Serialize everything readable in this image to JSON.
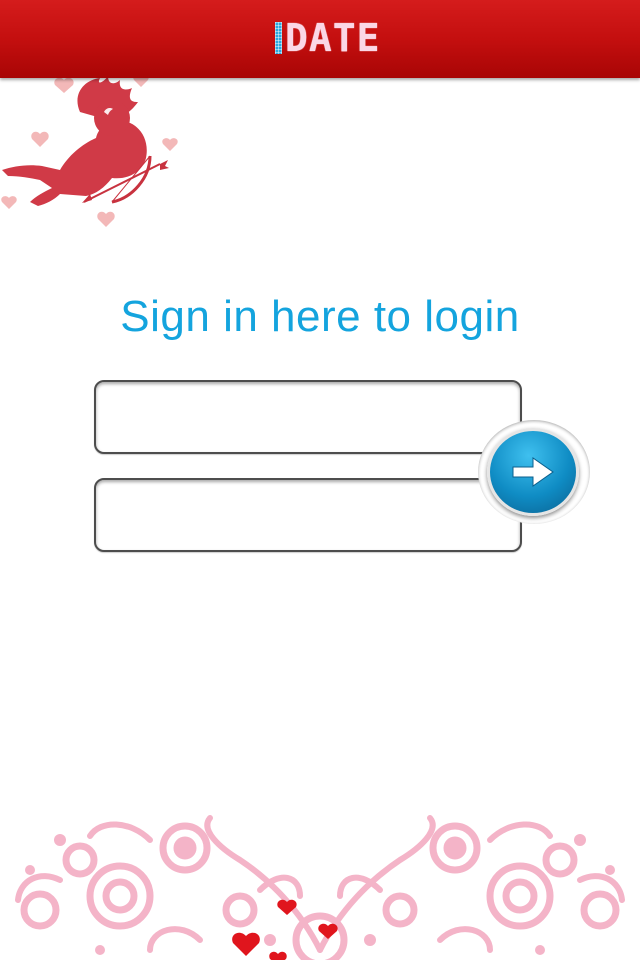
{
  "header": {
    "logo_text": "DATE",
    "bar_color": "#c40f0f",
    "logo_accent": "#2aa8e0"
  },
  "login": {
    "title": "Sign in here to login",
    "title_color": "#14a4de",
    "username_value": "",
    "password_value": "",
    "submit_icon": "arrow-right-icon"
  },
  "decor": {
    "top_left": "cupid-with-bow-icon",
    "bottom": "floral-heart-ornament"
  }
}
